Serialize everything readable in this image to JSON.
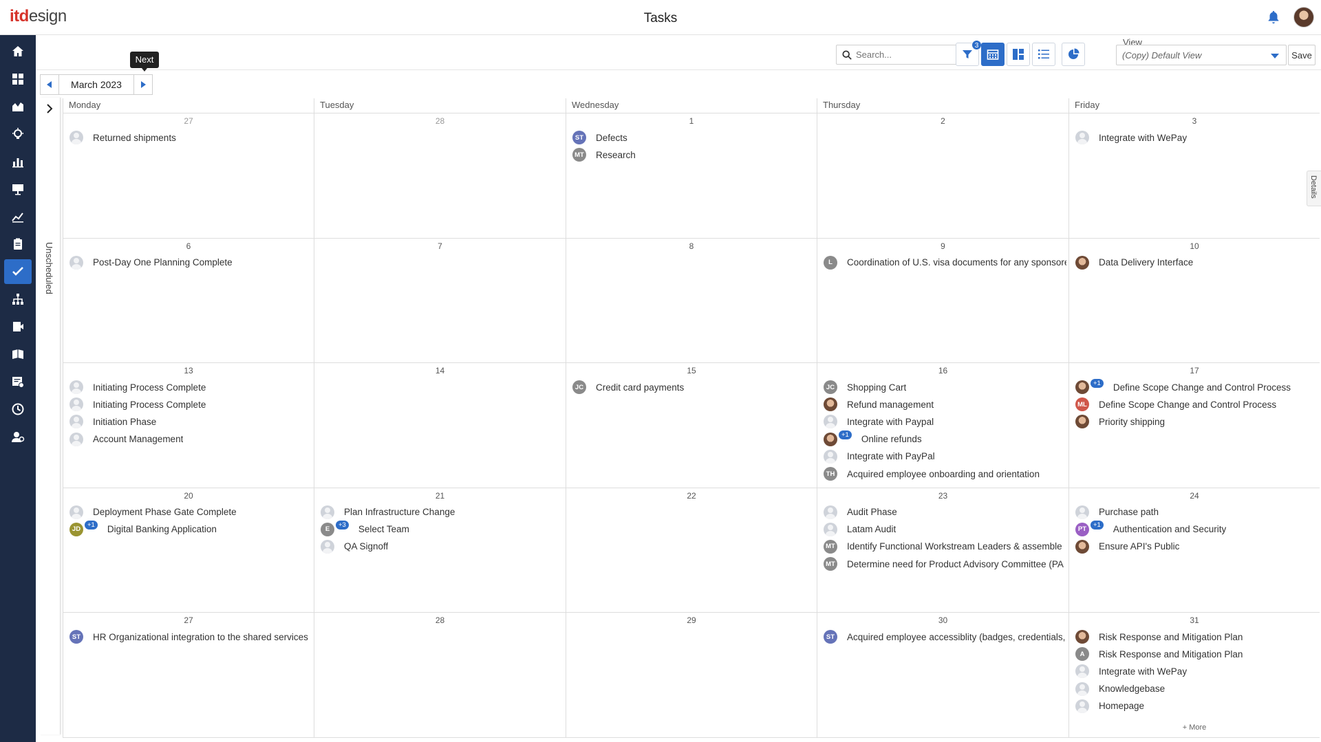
{
  "app": {
    "logo_it": "itd",
    "logo_design": "esign",
    "title": "Tasks"
  },
  "toolbar": {
    "search_placeholder": "Search...",
    "filter_count": "3",
    "view_label": "View",
    "view_value": "(Copy) Default View",
    "save_label": "Save"
  },
  "nav": {
    "month": "March 2023",
    "tooltip": "Next"
  },
  "unscheduled_label": "Unscheduled",
  "details_label": "Details",
  "more_label": "+ More",
  "weekdays": [
    "Monday",
    "Tuesday",
    "Wednesday",
    "Thursday",
    "Friday"
  ],
  "weeks": [
    [
      {
        "day": "27",
        "muted": true,
        "tasks": [
          {
            "av": "generic",
            "text": "Returned shipments"
          }
        ]
      },
      {
        "day": "28",
        "muted": true,
        "tasks": []
      },
      {
        "day": "1",
        "tasks": [
          {
            "av": "ST",
            "color": "#6573b8",
            "text": "Defects"
          },
          {
            "av": "MT",
            "color": "#8a8a8a",
            "text": "Research"
          }
        ]
      },
      {
        "day": "2",
        "tasks": []
      },
      {
        "day": "3",
        "tasks": [
          {
            "av": "generic",
            "text": "Integrate with WePay"
          }
        ]
      }
    ],
    [
      {
        "day": "6",
        "tasks": [
          {
            "av": "generic",
            "text": "Post-Day One Planning Complete"
          }
        ]
      },
      {
        "day": "7",
        "tasks": []
      },
      {
        "day": "8",
        "tasks": []
      },
      {
        "day": "9",
        "tasks": [
          {
            "av": "L",
            "color": "#8a8a8a",
            "text": "Coordination of U.S. visa documents for any sponsored"
          }
        ]
      },
      {
        "day": "10",
        "tasks": [
          {
            "av": "photo",
            "text": "Data Delivery Interface"
          }
        ]
      }
    ],
    [
      {
        "day": "13",
        "tasks": [
          {
            "av": "generic",
            "text": "Initiating Process Complete"
          },
          {
            "av": "generic",
            "text": "Initiating Process Complete"
          },
          {
            "av": "generic",
            "text": "Initiation Phase"
          },
          {
            "av": "generic",
            "text": "Account Management"
          }
        ]
      },
      {
        "day": "14",
        "tasks": []
      },
      {
        "day": "15",
        "tasks": [
          {
            "av": "JC",
            "color": "#8a8a8a",
            "text": "Credit card payments"
          }
        ]
      },
      {
        "day": "16",
        "tasks": [
          {
            "av": "JC",
            "color": "#8a8a8a",
            "text": "Shopping Cart"
          },
          {
            "av": "photo",
            "text": "Refund management"
          },
          {
            "av": "generic",
            "text": "Integrate with Paypal"
          },
          {
            "av": "photo",
            "plus": "+1",
            "text": "Online refunds"
          },
          {
            "av": "generic",
            "text": "Integrate with PayPal"
          },
          {
            "av": "TH",
            "color": "#8a8a8a",
            "text": "Acquired employee onboarding and orientation"
          }
        ]
      },
      {
        "day": "17",
        "tasks": [
          {
            "av": "photo",
            "plus": "+1",
            "text": "Define Scope Change and Control Process"
          },
          {
            "av": "ML",
            "color": "#d0574a",
            "text": "Define Scope Change and Control Process"
          },
          {
            "av": "photo",
            "text": "Priority shipping"
          }
        ]
      }
    ],
    [
      {
        "day": "20",
        "tasks": [
          {
            "av": "generic",
            "text": "Deployment Phase Gate Complete"
          },
          {
            "av": "JD",
            "color": "#9a9431",
            "plus": "+1",
            "text": "Digital Banking Application"
          }
        ]
      },
      {
        "day": "21",
        "tasks": [
          {
            "av": "generic",
            "text": "Plan Infrastructure Change"
          },
          {
            "av": "E",
            "color": "#8a8a8a",
            "plus": "+3",
            "text": "Select Team"
          },
          {
            "av": "generic",
            "text": "QA Signoff"
          }
        ]
      },
      {
        "day": "22",
        "tasks": []
      },
      {
        "day": "23",
        "tasks": [
          {
            "av": "generic",
            "text": "Audit Phase"
          },
          {
            "av": "generic",
            "text": "Latam Audit"
          },
          {
            "av": "MT",
            "color": "#8a8a8a",
            "text": "Identify Functional Workstream Leaders & assemble"
          },
          {
            "av": "MT",
            "color": "#8a8a8a",
            "text": "Determine need for Product Advisory Committee (PA"
          }
        ]
      },
      {
        "day": "24",
        "tasks": [
          {
            "av": "generic",
            "text": "Purchase path"
          },
          {
            "av": "PT",
            "color": "#9a5fc4",
            "plus": "+1",
            "text": "Authentication and Security"
          },
          {
            "av": "photo",
            "text": "Ensure API's Public"
          }
        ]
      }
    ],
    [
      {
        "day": "27",
        "tasks": [
          {
            "av": "ST",
            "color": "#6573b8",
            "text": "HR Organizational integration to the shared services"
          }
        ]
      },
      {
        "day": "28",
        "tasks": []
      },
      {
        "day": "29",
        "tasks": []
      },
      {
        "day": "30",
        "tasks": [
          {
            "av": "ST",
            "color": "#6573b8",
            "text": "Acquired employee accessiblity (badges, credentials,"
          }
        ]
      },
      {
        "day": "31",
        "more": true,
        "tasks": [
          {
            "av": "photo",
            "text": "Risk Response and Mitigation Plan"
          },
          {
            "av": "A",
            "color": "#8a8a8a",
            "text": "Risk Response and Mitigation Plan"
          },
          {
            "av": "generic",
            "text": "Integrate with WePay"
          },
          {
            "av": "generic",
            "text": "Knowledgebase"
          },
          {
            "av": "generic",
            "text": "Homepage"
          }
        ]
      }
    ]
  ],
  "sidebar_icons": [
    "home-icon",
    "dashboard-icon",
    "portfolio-icon",
    "ideas-icon",
    "reports-icon",
    "presentation-icon",
    "analytics-icon",
    "documents-icon",
    "tasks-icon",
    "org-chart-icon",
    "resources-icon",
    "library-icon",
    "timesheet-icon",
    "time-icon",
    "admin-icon"
  ],
  "colors": {
    "sidebar": "#1d2b45",
    "accent": "#2d6dc8"
  }
}
